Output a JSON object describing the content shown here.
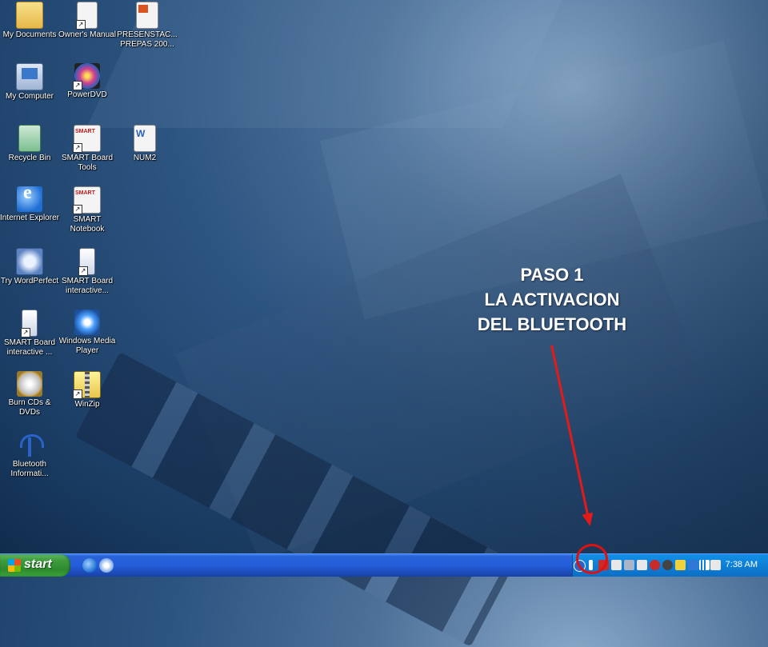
{
  "desktop": {
    "icons": [
      {
        "label": "My Documents",
        "icon": "my-documents-icon"
      },
      {
        "label": "Owner's Manual",
        "icon": "owners-manual-icon"
      },
      {
        "label": "PRESENSTAC... PREPAS 200...",
        "icon": "powerpoint-file-icon"
      },
      {
        "label": "My Computer",
        "icon": "my-computer-icon"
      },
      {
        "label": "PowerDVD",
        "icon": "powerdvd-icon"
      },
      {
        "label": "Recycle Bin",
        "icon": "recycle-bin-icon"
      },
      {
        "label": "SMART Board Tools",
        "icon": "smart-board-tools-icon"
      },
      {
        "label": "NUM2",
        "icon": "word-document-icon"
      },
      {
        "label": "Internet Explorer",
        "icon": "internet-explorer-icon"
      },
      {
        "label": "SMART Notebook",
        "icon": "smart-notebook-icon"
      },
      {
        "label": "Try WordPerfect",
        "icon": "wordperfect-icon"
      },
      {
        "label": "SMART Board interactive...",
        "icon": "smart-board-interactive-icon"
      },
      {
        "label": "SMART Board interactive ...",
        "icon": "smart-board-interactive-icon"
      },
      {
        "label": "Windows Media Player",
        "icon": "windows-media-player-icon"
      },
      {
        "label": "Burn CDs & DVDs",
        "icon": "burn-cd-icon"
      },
      {
        "label": "WinZip",
        "icon": "winzip-icon"
      },
      {
        "label": "Bluetooth Informati...",
        "icon": "bluetooth-icon"
      }
    ]
  },
  "annotation": {
    "line1": "PASO 1",
    "line2": "LA ACTIVACION",
    "line3": "DEL BLUETOOTH",
    "color": "#e41a1a"
  },
  "taskbar": {
    "start_label": "start",
    "quick_launch": [
      "internet-explorer-icon",
      "show-desktop-icon"
    ],
    "tray_icons": [
      "bluetooth-tray-icon",
      "network-tray-icon",
      "security-tray-icon",
      "display-tray-icon",
      "monitor-tray-icon",
      "sound-tray-icon",
      "alert-tray-icon",
      "player-tray-icon",
      "power-tray-icon",
      "battery-tray-icon",
      "wireless-tray-icon",
      "volume-tray-icon"
    ],
    "clock": "7:38 AM"
  }
}
